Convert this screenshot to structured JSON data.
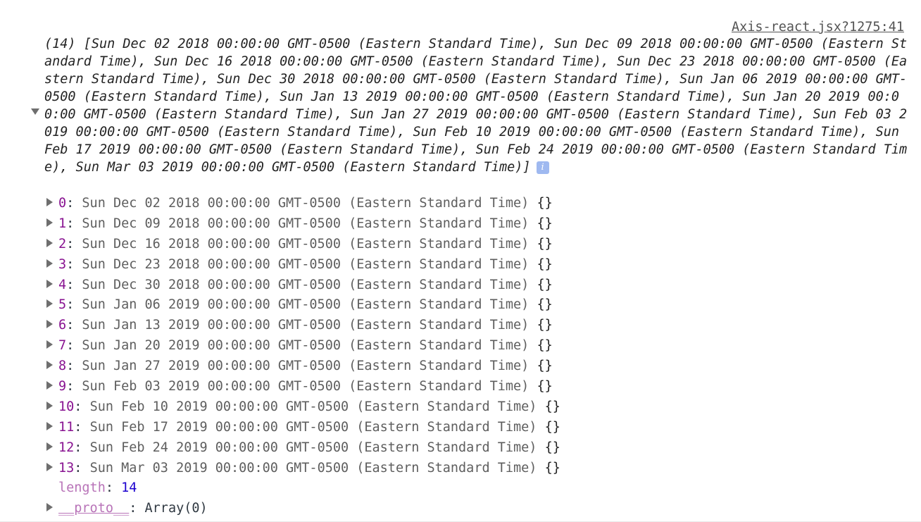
{
  "source": "Axis-react.jsx?1275:41",
  "summary": {
    "text": "(14) [Sun Dec 02 2018 00:00:00 GMT-0500 (Eastern Standard Time), Sun Dec 09 2018 00:00:00 GMT-0500 (Eastern Standard Time), Sun Dec 16 2018 00:00:00 GMT-0500 (Eastern Standard Time), Sun Dec 23 2018 00:00:00 GMT-0500 (Eastern Standard Time), Sun Dec 30 2018 00:00:00 GMT-0500 (Eastern Standard Time), Sun Jan 06 2019 00:00:00 GMT-0500 (Eastern Standard Time), Sun Jan 13 2019 00:00:00 GMT-0500 (Eastern Standard Time), Sun Jan 20 2019 00:00:00 GMT-0500 (Eastern Standard Time), Sun Jan 27 2019 00:00:00 GMT-0500 (Eastern Standard Time), Sun Feb 03 2019 00:00:00 GMT-0500 (Eastern Standard Time), Sun Feb 10 2019 00:00:00 GMT-0500 (Eastern Standard Time), Sun Feb 17 2019 00:00:00 GMT-0500 (Eastern Standard Time), Sun Feb 24 2019 00:00:00 GMT-0500 (Eastern Standard Time), Sun Mar 03 2019 00:00:00 GMT-0500 (Eastern Standard Time)]",
    "info_icon": "i"
  },
  "items": [
    {
      "key": "0",
      "value": "Sun Dec 02 2018 00:00:00 GMT-0500 (Eastern Standard Time)",
      "suffix": "{}"
    },
    {
      "key": "1",
      "value": "Sun Dec 09 2018 00:00:00 GMT-0500 (Eastern Standard Time)",
      "suffix": "{}"
    },
    {
      "key": "2",
      "value": "Sun Dec 16 2018 00:00:00 GMT-0500 (Eastern Standard Time)",
      "suffix": "{}"
    },
    {
      "key": "3",
      "value": "Sun Dec 23 2018 00:00:00 GMT-0500 (Eastern Standard Time)",
      "suffix": "{}"
    },
    {
      "key": "4",
      "value": "Sun Dec 30 2018 00:00:00 GMT-0500 (Eastern Standard Time)",
      "suffix": "{}"
    },
    {
      "key": "5",
      "value": "Sun Jan 06 2019 00:00:00 GMT-0500 (Eastern Standard Time)",
      "suffix": "{}"
    },
    {
      "key": "6",
      "value": "Sun Jan 13 2019 00:00:00 GMT-0500 (Eastern Standard Time)",
      "suffix": "{}"
    },
    {
      "key": "7",
      "value": "Sun Jan 20 2019 00:00:00 GMT-0500 (Eastern Standard Time)",
      "suffix": "{}"
    },
    {
      "key": "8",
      "value": "Sun Jan 27 2019 00:00:00 GMT-0500 (Eastern Standard Time)",
      "suffix": "{}"
    },
    {
      "key": "9",
      "value": "Sun Feb 03 2019 00:00:00 GMT-0500 (Eastern Standard Time)",
      "suffix": "{}"
    },
    {
      "key": "10",
      "value": "Sun Feb 10 2019 00:00:00 GMT-0500 (Eastern Standard Time)",
      "suffix": "{}"
    },
    {
      "key": "11",
      "value": "Sun Feb 17 2019 00:00:00 GMT-0500 (Eastern Standard Time)",
      "suffix": "{}"
    },
    {
      "key": "12",
      "value": "Sun Feb 24 2019 00:00:00 GMT-0500 (Eastern Standard Time)",
      "suffix": "{}"
    },
    {
      "key": "13",
      "value": "Sun Mar 03 2019 00:00:00 GMT-0500 (Eastern Standard Time)",
      "suffix": "{}"
    }
  ],
  "length": {
    "key": "length",
    "value": "14"
  },
  "proto": {
    "key": "__proto__",
    "value": "Array(0)"
  },
  "separator": ": ",
  "colors": {
    "key": "#881391",
    "number": "#1c00cf",
    "date": "#5e5e5e",
    "link": "#545454"
  }
}
